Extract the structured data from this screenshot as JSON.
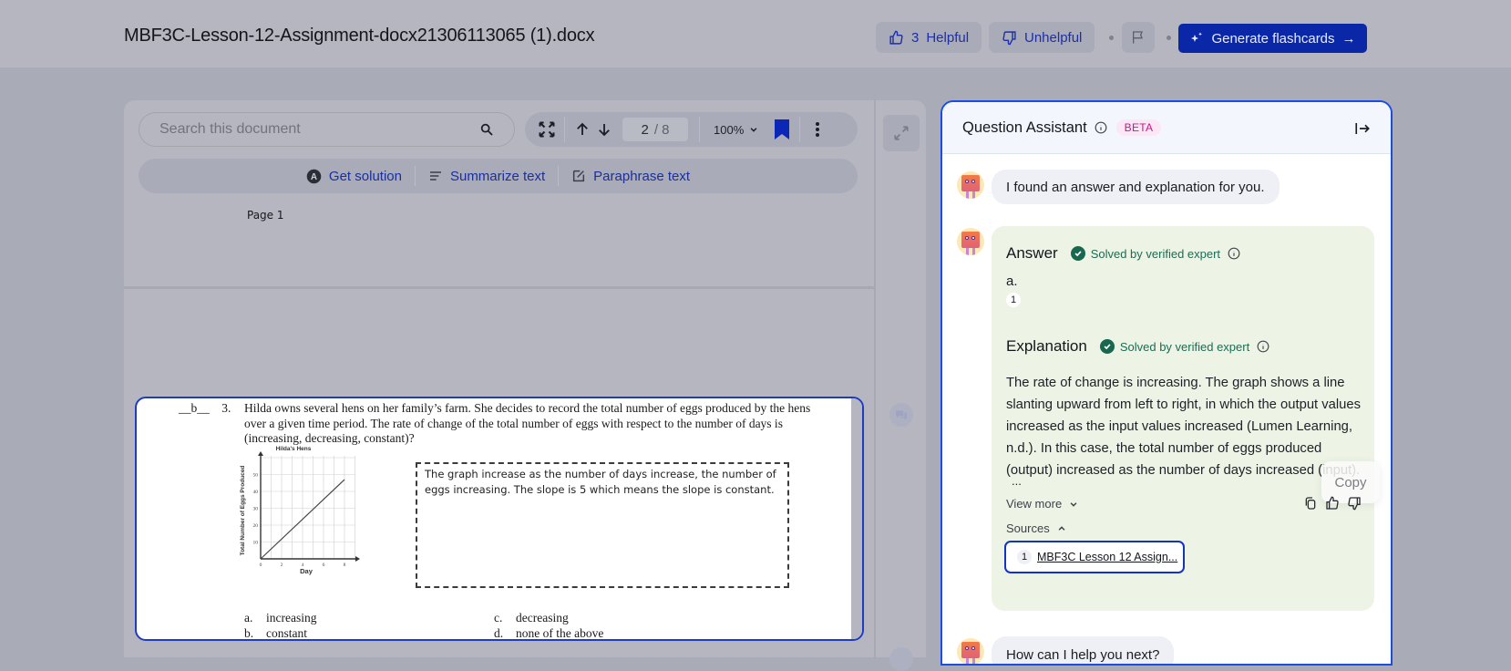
{
  "header": {
    "doc_title": "MBF3C-Lesson-12-Assignment-docx21306113065 (1).docx",
    "helpful_count": "3",
    "helpful_label": "Helpful",
    "unhelpful_label": "Unhelpful",
    "generate_label": "Generate flashcards"
  },
  "viewer": {
    "search_placeholder": "Search this document",
    "page_current": "2",
    "page_total": "/ 8",
    "zoom_level": "100%",
    "actions": {
      "get_solution": "Get solution",
      "summarize": "Summarize text",
      "paraphrase": "Paraphrase text"
    },
    "page_label": "Page 1"
  },
  "question": {
    "answer_blank": "__b__",
    "number": "3.",
    "text": "Hilda owns several hens on her family’s farm. She decides to record the total number of eggs produced by the hens over a given time period. The rate of change of the total number of eggs with respect to the number of days is (increasing, decreasing, constant)?",
    "graph": {
      "title": "Hilda's Hens",
      "xlabel": "Day",
      "ylabel": "Total Number of Eggs Produced",
      "x_ticks": [
        "0",
        "2",
        "4",
        "6",
        "8"
      ],
      "y_ticks": [
        "10",
        "20",
        "30",
        "40",
        "50"
      ]
    },
    "student_note": "The graph increase as the number of days increase, the number of eggs increasing. The slope is 5 which means the slope is constant.",
    "choices": [
      {
        "letter": "a.",
        "text": "increasing"
      },
      {
        "letter": "b.",
        "text": "constant"
      },
      {
        "letter": "c.",
        "text": "decreasing"
      },
      {
        "letter": "d.",
        "text": "none of the above"
      }
    ]
  },
  "assistant": {
    "title": "Question Assistant",
    "badge": "BETA",
    "intro_message": "I found an answer and explanation for you.",
    "answer_heading": "Answer",
    "verified_label": "Solved by verified expert",
    "answer_value": "a.",
    "answer_citation": "1",
    "explanation_heading": "Explanation",
    "explanation_text": "The rate of change is increasing. The graph shows a line slanting upward from left to right, in which the output values increased as the input values increased (Lumen Learning, n.d.). In this case, the total number of eggs produced (output) increased as the number of days increased (input).",
    "ellipsis": "...",
    "copy_tooltip": "Copy",
    "view_more": "View more",
    "sources_label": "Sources",
    "sources": [
      {
        "n": "1",
        "title": "MBF3C Lesson 12 Assign..."
      }
    ],
    "next_message": "How can I help you next?"
  }
}
